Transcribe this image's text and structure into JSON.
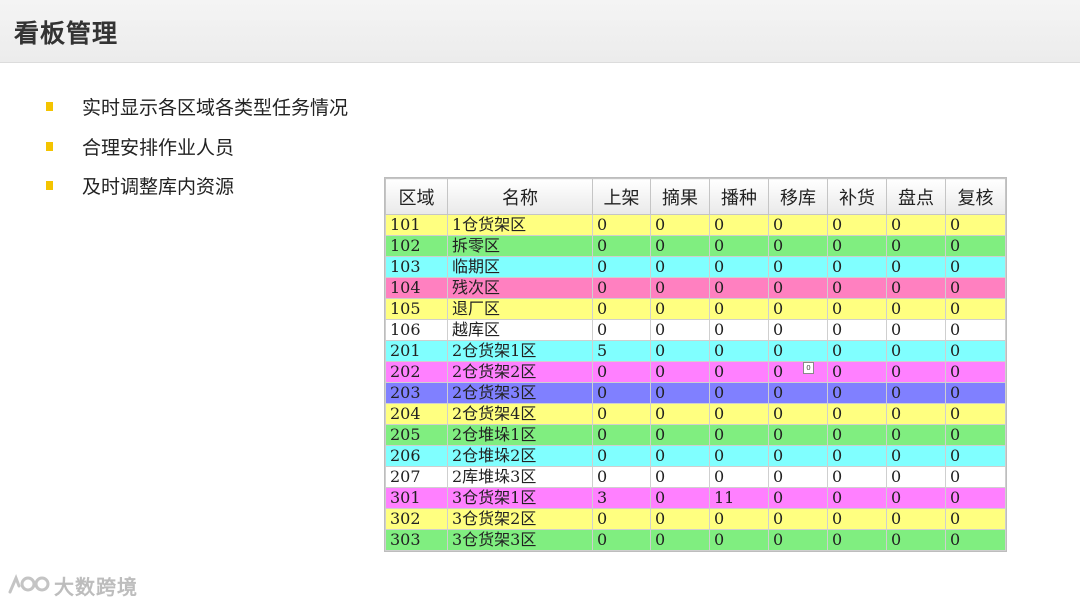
{
  "page": {
    "title": "看板管理"
  },
  "bullets": [
    "实时显示各区域各类型任务情况",
    "合理安排作业人员",
    "及时调整库内资源"
  ],
  "board": {
    "headers": [
      "区域",
      "名称",
      "上架",
      "摘果",
      "播种",
      "移库",
      "补货",
      "盘点",
      "复核"
    ],
    "rows": [
      {
        "color": "#ffff80",
        "cells": [
          "101",
          "1仓货架区",
          "0",
          "0",
          "0",
          "0",
          "0",
          "0",
          "0"
        ]
      },
      {
        "color": "#80ee80",
        "cells": [
          "102",
          "拆零区",
          "0",
          "0",
          "0",
          "0",
          "0",
          "0",
          "0"
        ]
      },
      {
        "color": "#80ffff",
        "cells": [
          "103",
          "临期区",
          "0",
          "0",
          "0",
          "0",
          "0",
          "0",
          "0"
        ]
      },
      {
        "color": "#ff80c0",
        "cells": [
          "104",
          "残次区",
          "0",
          "0",
          "0",
          "0",
          "0",
          "0",
          "0"
        ]
      },
      {
        "color": "#ffff80",
        "cells": [
          "105",
          "退厂区",
          "0",
          "0",
          "0",
          "0",
          "0",
          "0",
          "0"
        ]
      },
      {
        "color": "#ffffff",
        "cells": [
          "106",
          "越库区",
          "0",
          "0",
          "0",
          "0",
          "0",
          "0",
          "0"
        ]
      },
      {
        "color": "#80ffff",
        "cells": [
          "201",
          "2仓货架1区",
          "5",
          "0",
          "0",
          "0",
          "0",
          "0",
          "0"
        ]
      },
      {
        "color": "#ff80ff",
        "cells": [
          "202",
          "2仓货架2区",
          "0",
          "0",
          "0",
          "0",
          "0",
          "0",
          "0"
        ]
      },
      {
        "color": "#8080ff",
        "cells": [
          "203",
          "2仓货架3区",
          "0",
          "0",
          "0",
          "0",
          "0",
          "0",
          "0"
        ]
      },
      {
        "color": "#ffff80",
        "cells": [
          "204",
          "2仓货架4区",
          "0",
          "0",
          "0",
          "0",
          "0",
          "0",
          "0"
        ]
      },
      {
        "color": "#80ee80",
        "cells": [
          "205",
          "2仓堆垛1区",
          "0",
          "0",
          "0",
          "0",
          "0",
          "0",
          "0"
        ]
      },
      {
        "color": "#80ffff",
        "cells": [
          "206",
          "2仓堆垛2区",
          "0",
          "0",
          "0",
          "0",
          "0",
          "0",
          "0"
        ]
      },
      {
        "color": "#ffffff",
        "cells": [
          "207",
          "2库堆垛3区",
          "0",
          "0",
          "0",
          "0",
          "0",
          "0",
          "0"
        ]
      },
      {
        "color": "#ff80ff",
        "cells": [
          "301",
          "3仓货架1区",
          "3",
          "0",
          "11",
          "0",
          "0",
          "0",
          "0"
        ]
      },
      {
        "color": "#ffff80",
        "cells": [
          "302",
          "3仓货架2区",
          "0",
          "0",
          "0",
          "0",
          "0",
          "0",
          "0"
        ]
      },
      {
        "color": "#80ee80",
        "cells": [
          "303",
          "3仓货架3区",
          "0",
          "0",
          "0",
          "0",
          "0",
          "0",
          "0"
        ]
      }
    ],
    "tooltip": "0"
  },
  "watermark": {
    "text": "大数跨境",
    "icon": "brand-logo-icon"
  },
  "colors": {
    "bullet_accent": "#f4c400",
    "header_bar": "#f0f0f0"
  }
}
